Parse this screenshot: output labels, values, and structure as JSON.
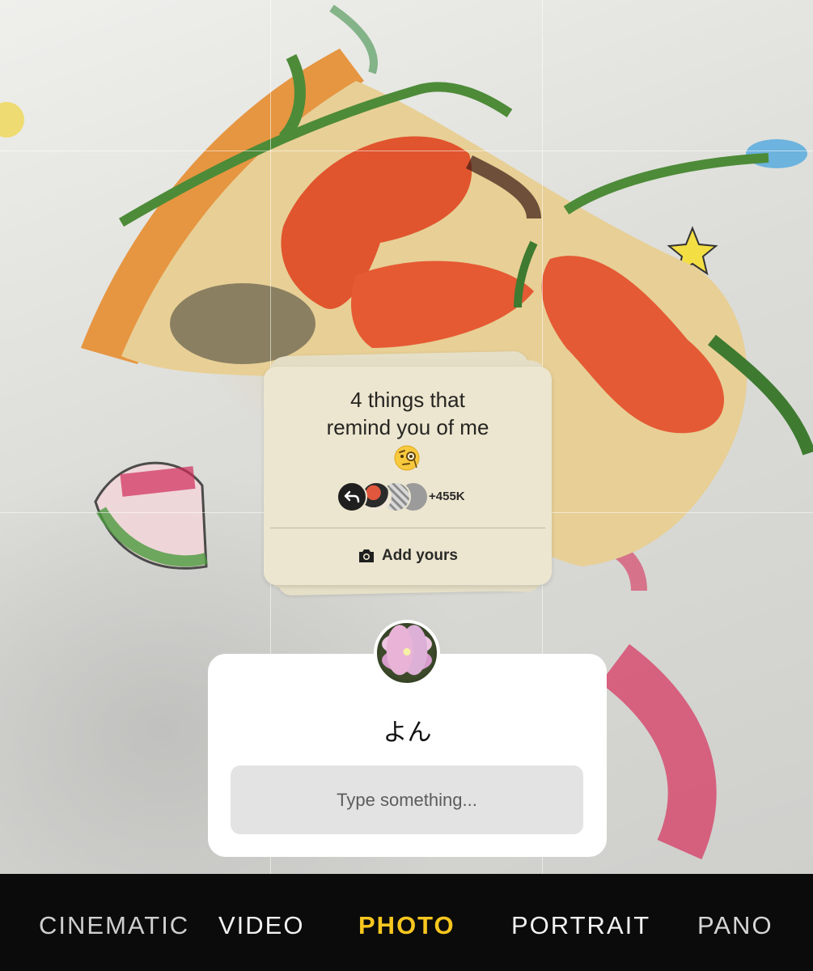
{
  "sticker": {
    "title_line1": "4 things that",
    "title_line2": "remind you of me",
    "emoji_icon": "face-with-monocle-icon",
    "participant_count": "+455K",
    "action_label": "Add yours"
  },
  "question_card": {
    "name": "よん",
    "input_placeholder": "Type something..."
  },
  "camera_modes": {
    "items": [
      "CINEMATIC",
      "VIDEO",
      "PHOTO",
      "PORTRAIT",
      "PANO"
    ],
    "selected": "PHOTO",
    "selected_color": "#f7c71f"
  },
  "colors": {
    "sticker_bg": "#ece6d1",
    "mode_bar_bg": "#0b0b0b"
  }
}
